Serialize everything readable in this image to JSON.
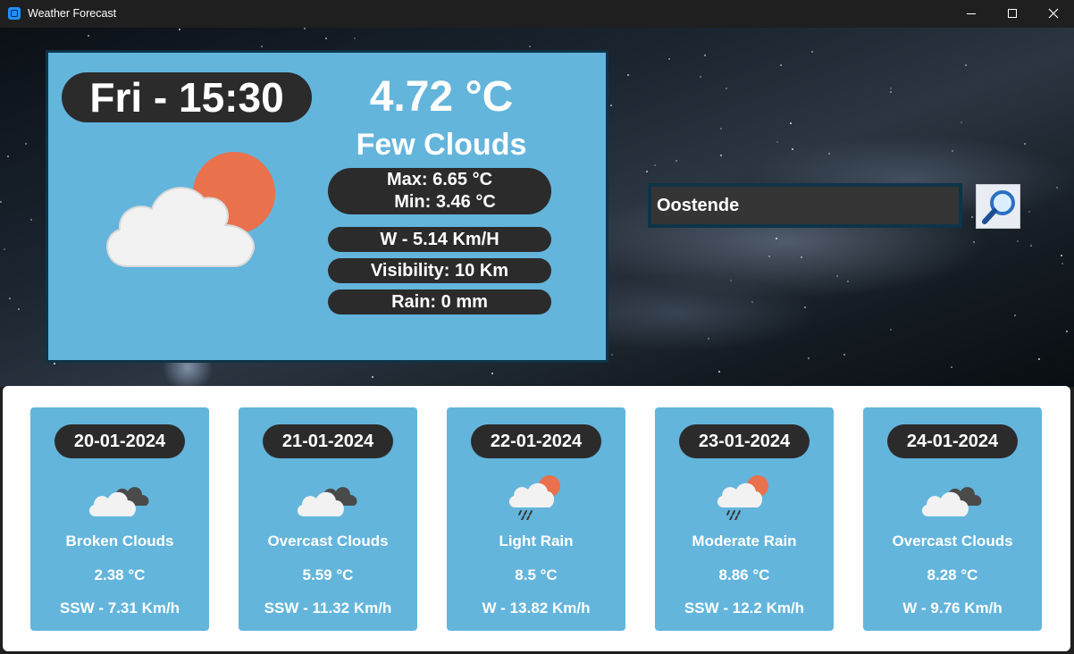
{
  "window": {
    "title": "Weather Forecast"
  },
  "current": {
    "day_time": "Fri - 15:30",
    "temperature": "4.72 °C",
    "description": "Few Clouds",
    "max": "Max: 6.65 °C",
    "min": "Min: 3.46 °C",
    "wind": "W - 5.14 Km/H",
    "visibility": "Visibility: 10 Km",
    "rain": "Rain: 0 mm",
    "icon": "cloud-sun-icon"
  },
  "search": {
    "value": "Oostende",
    "button_icon": "magnifier-icon"
  },
  "forecast": [
    {
      "date": "20-01-2024",
      "description": "Broken Clouds",
      "temperature": "2.38 °C",
      "wind": "SSW - 7.31 Km/h",
      "icon": "broken-clouds-icon"
    },
    {
      "date": "21-01-2024",
      "description": "Overcast Clouds",
      "temperature": "5.59 °C",
      "wind": "SSW - 11.32 Km/h",
      "icon": "overcast-clouds-icon"
    },
    {
      "date": "22-01-2024",
      "description": "Light Rain",
      "temperature": "8.5 °C",
      "wind": "W - 13.82 Km/h",
      "icon": "rain-sun-cloud-icon"
    },
    {
      "date": "23-01-2024",
      "description": "Moderate Rain",
      "temperature": "8.86 °C",
      "wind": "SSW - 12.2 Km/h",
      "icon": "rain-sun-cloud-icon"
    },
    {
      "date": "24-01-2024",
      "description": "Overcast Clouds",
      "temperature": "8.28 °C",
      "wind": "W - 9.76 Km/h",
      "icon": "overcast-clouds-icon"
    }
  ],
  "colors": {
    "panel": "#63b5dc",
    "pill": "#2b2b2b",
    "panel_border": "#0e3448",
    "sun": "#e9714c"
  }
}
